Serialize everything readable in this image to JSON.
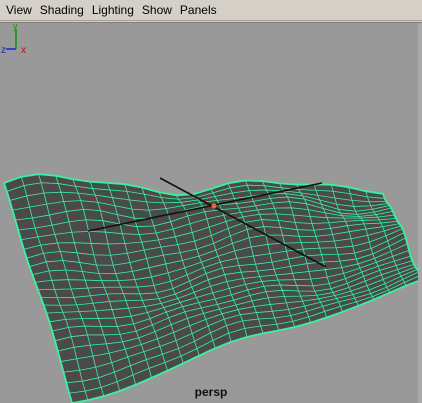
{
  "menubar": {
    "items": [
      {
        "label": "View"
      },
      {
        "label": "Shading"
      },
      {
        "label": "Lighting"
      },
      {
        "label": "Show"
      },
      {
        "label": "Panels"
      }
    ]
  },
  "viewport": {
    "camera": "persp",
    "background_color": "#999999",
    "mesh_fill_color": "#4a4a4a",
    "wire_color": "#3cf0a0",
    "axes": {
      "y": "y",
      "z": "z",
      "x": "x"
    },
    "axis_colors": {
      "y": "#00a000",
      "z": "#2020d0",
      "x": "#d00000"
    }
  }
}
